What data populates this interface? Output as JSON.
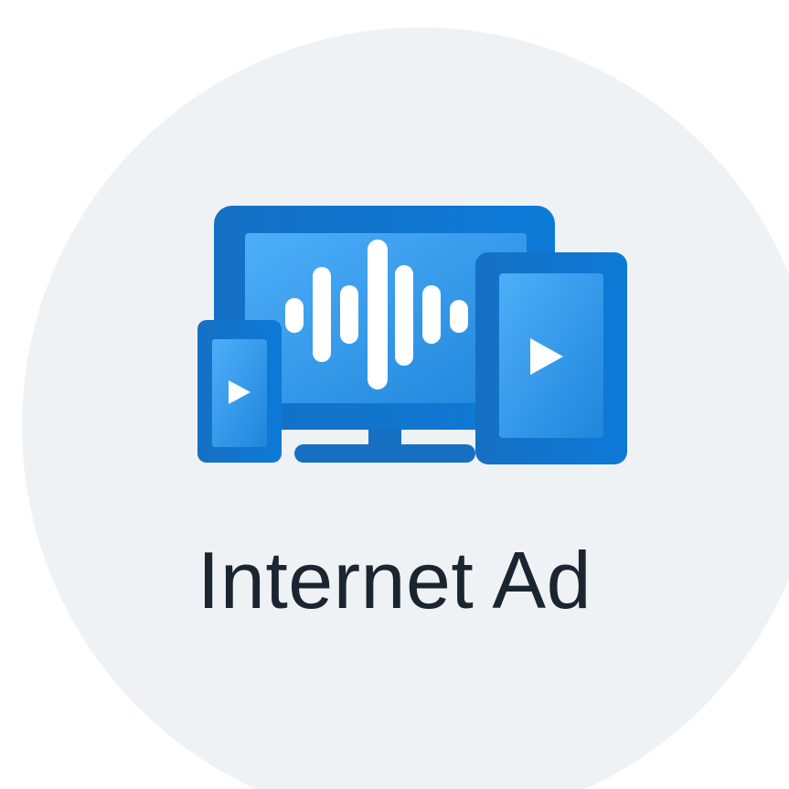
{
  "label": "Internet Ad",
  "icon": "multi-device-media-icon",
  "colors": {
    "background_circle": "#eff2f5",
    "device_frame": "#1477cc",
    "screen_light": "#49a8f5",
    "screen_dark": "#1f86dc",
    "glyph": "#ffffff",
    "text": "#1b2530"
  }
}
